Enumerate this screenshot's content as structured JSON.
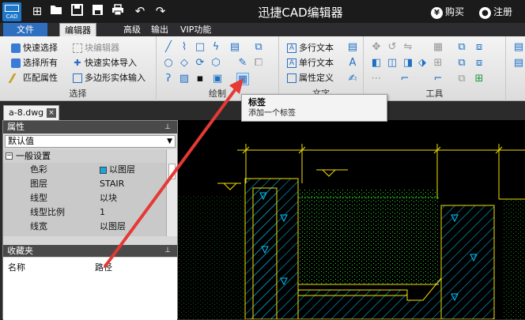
{
  "titlebar": {
    "logo_text": "CAD",
    "title": "迅捷CAD编辑器",
    "buy_label": "购买",
    "login_label": "注册",
    "buy_icon": "¥",
    "login_icon": "person-icon"
  },
  "menubar": {
    "items": [
      {
        "label": "文件"
      },
      {
        "label": "编辑器"
      },
      {
        "label": "高级"
      },
      {
        "label": "输出"
      },
      {
        "label": "VIP功能"
      }
    ]
  },
  "ribbon": {
    "select_group": {
      "label": "选择",
      "items": [
        {
          "label": "快速选择"
        },
        {
          "label": "选择所有"
        },
        {
          "label": "匹配属性"
        },
        {
          "label": "块编辑器"
        },
        {
          "label": "快速实体导入"
        },
        {
          "label": "多边形实体输入"
        }
      ]
    },
    "draw_group": {
      "label": "绘制"
    },
    "text_group": {
      "label": "文字",
      "items": [
        {
          "label": "多行文本"
        },
        {
          "label": "单行文本"
        },
        {
          "label": "属性定义"
        }
      ]
    },
    "tools_group": {
      "label": "工具"
    }
  },
  "tooltip": {
    "title": "标签",
    "description": "添加一个标签"
  },
  "document_tab": {
    "label": "a-8.dwg",
    "close_label": "×"
  },
  "properties": {
    "header": "属性",
    "dropdown_value": "默认值",
    "category": "一般设置",
    "rows": [
      {
        "name": "色彩",
        "value": "以图层"
      },
      {
        "name": "图层",
        "value": "STAIR"
      },
      {
        "name": "线型",
        "value": "以块"
      },
      {
        "name": "线型比例",
        "value": "1"
      },
      {
        "name": "线宽",
        "value": "以图层"
      }
    ]
  },
  "favorites": {
    "header": "收藏夹",
    "columns": [
      {
        "label": "名称"
      },
      {
        "label": "路径"
      }
    ]
  },
  "colors": {
    "accent": "#2f6fc0",
    "titlebar": "#1b1b1b",
    "cad_yellow": "#f5e000",
    "cad_cyan": "#00c8ff",
    "cad_green": "#22e022",
    "arrow_red": "#e53935"
  }
}
